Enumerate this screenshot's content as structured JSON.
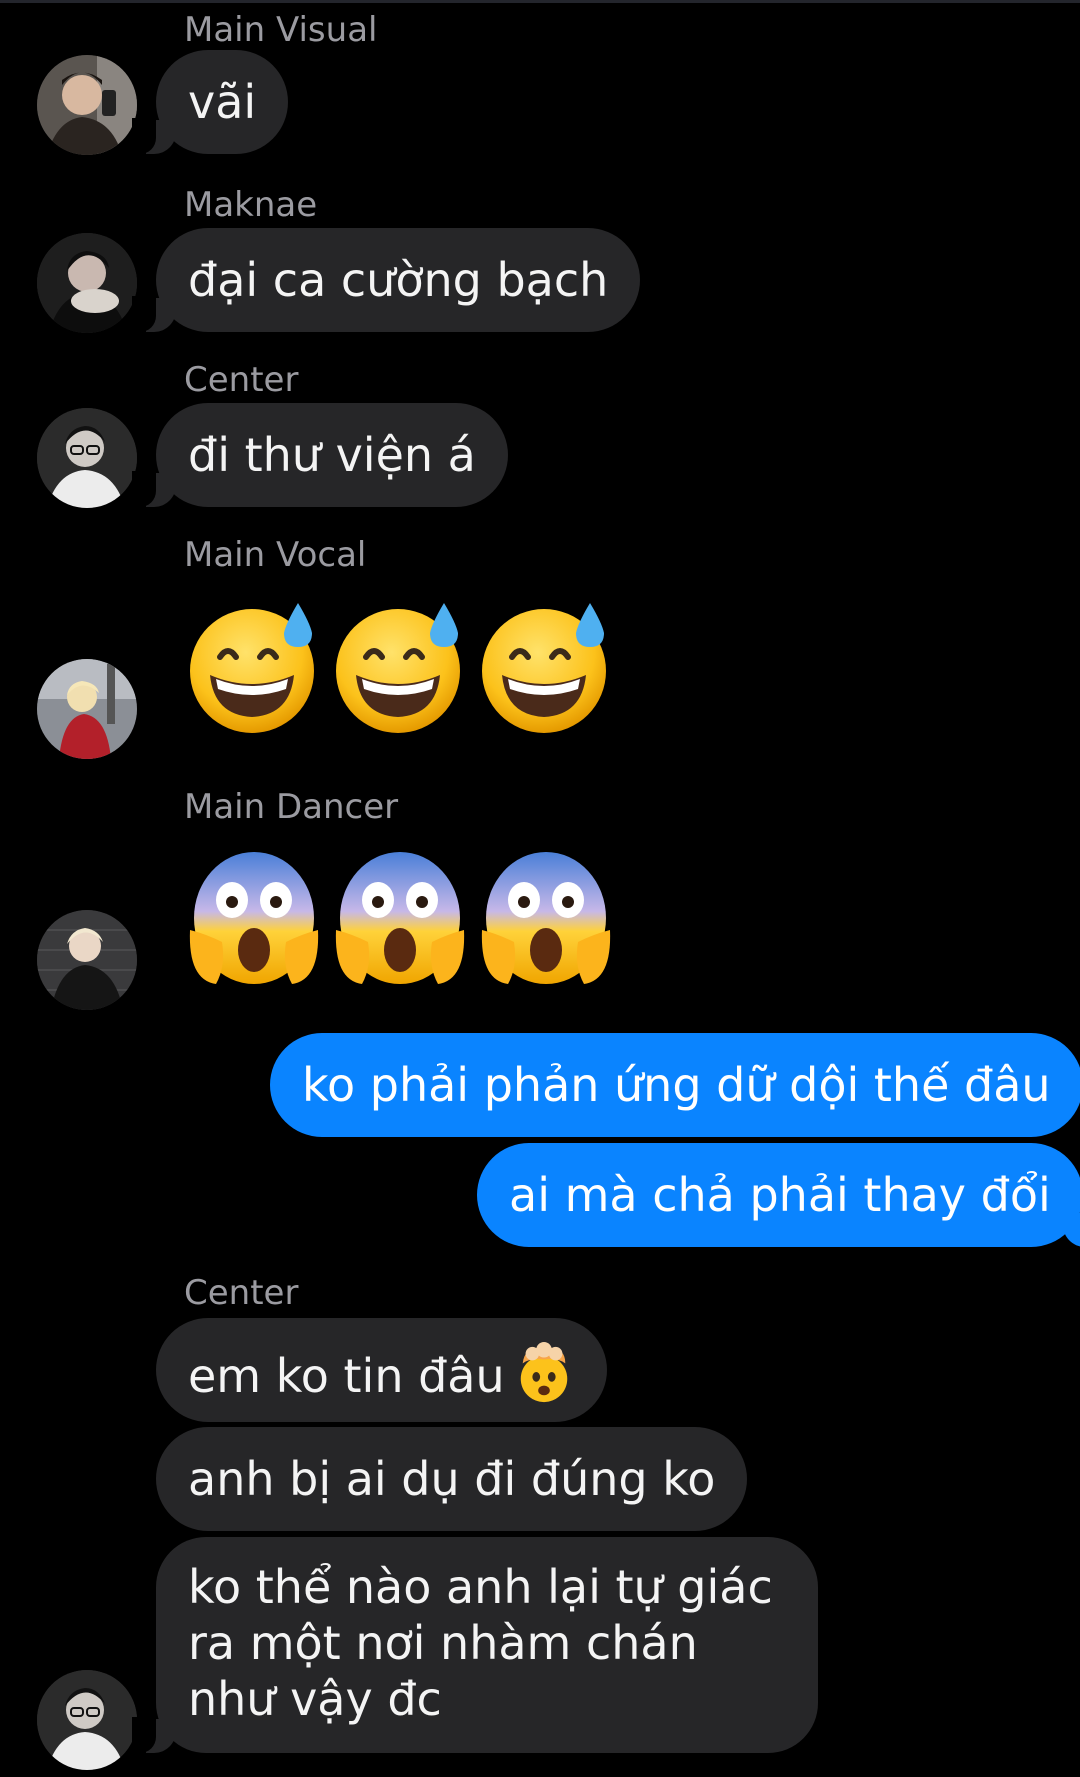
{
  "conversation": {
    "messages": [
      {
        "sender": "Main Visual",
        "text": "vãi"
      },
      {
        "sender": "Maknae",
        "text": "đại ca cường bạch"
      },
      {
        "sender": "Center",
        "text": "đi thư viện á"
      },
      {
        "sender": "Main Vocal",
        "emoji": "grinning-face-with-sweat",
        "count": 3
      },
      {
        "sender": "Main Dancer",
        "emoji": "face-screaming-in-fear",
        "count": 3
      }
    ],
    "outgoing": [
      {
        "text": "ko phải phản ứng dữ dội thế đâu"
      },
      {
        "text": "ai mà chả phải thay đổi"
      }
    ],
    "center_group": {
      "sender": "Center",
      "messages": [
        {
          "text": "em ko tin đâu",
          "emoji": "exploding-head"
        },
        {
          "text": "anh bị ai dụ đi đúng ko"
        },
        {
          "text": "ko thể nào anh lại tự giác ra một nơi nhàm chán như vậy đc"
        }
      ]
    }
  },
  "colors": {
    "background": "#000000",
    "incoming_bubble": "#262628",
    "outgoing_bubble": "#0a84ff",
    "sender_label": "#9b9ba1"
  }
}
